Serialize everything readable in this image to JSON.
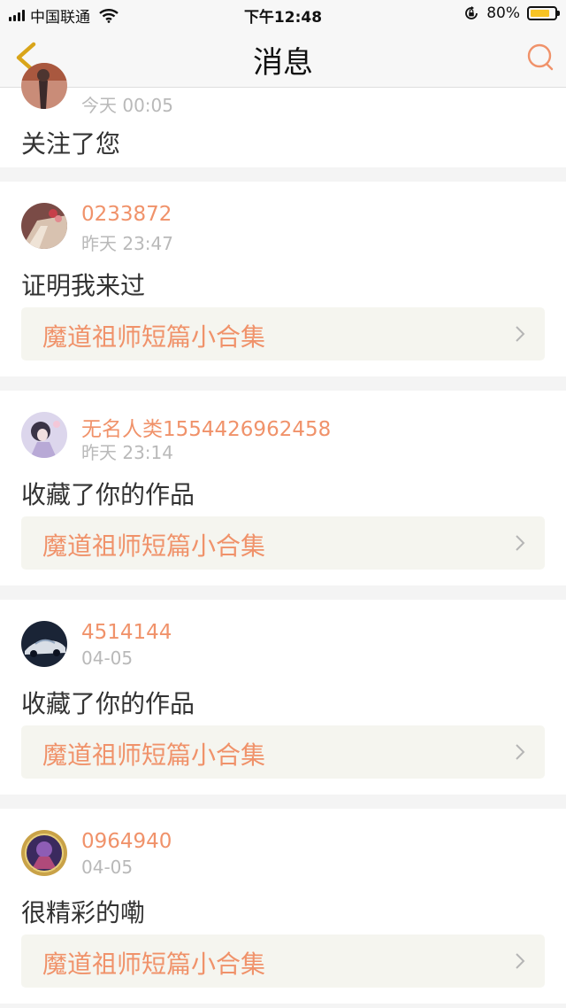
{
  "status_bar": {
    "carrier": "中国联通",
    "time": "下午12:48",
    "battery": "80%",
    "battery_level": 0.8,
    "icons": [
      "signal-icon",
      "wifi-icon",
      "orientation-lock-icon",
      "battery-icon"
    ]
  },
  "nav": {
    "title": "消息",
    "back_icon": "back-chevron-icon",
    "search_icon": "search-icon"
  },
  "colors": {
    "accent": "#f0926a",
    "back": "#d9a51a",
    "link_bg": "#f5f5ef"
  },
  "notifications": [
    {
      "time": "今天 00:05",
      "message": "关注了您"
    },
    {
      "user": "0233872",
      "time": "昨天 23:47",
      "message": "证明我来过",
      "work": "魔道祖师短篇小合集"
    },
    {
      "user": "无名人类1554426962458",
      "time": "昨天 23:14",
      "message": "收藏了你的作品",
      "work": "魔道祖师短篇小合集"
    },
    {
      "user": "4514144",
      "time": "04-05",
      "message": "收藏了你的作品",
      "work": "魔道祖师短篇小合集"
    },
    {
      "user": "0964940",
      "time": "04-05",
      "message": "很精彩的嘞",
      "work": "魔道祖师短篇小合集"
    }
  ]
}
